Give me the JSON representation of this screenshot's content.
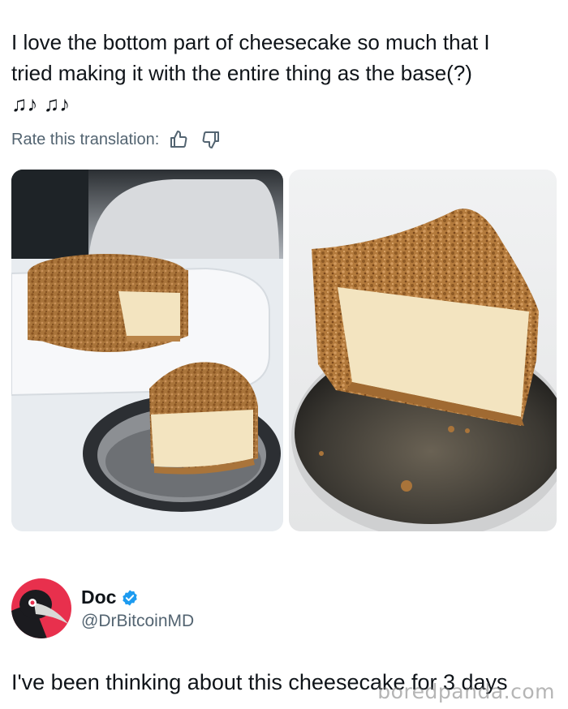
{
  "post": {
    "line1": "I love the bottom part of cheesecake so much that I",
    "line2": "tried making it with the entire thing as the base(?)",
    "line3": "♫♪ ♫♪"
  },
  "translation": {
    "label": "Rate this translation:",
    "thumbs_up_icon": "thumbs-up-icon",
    "thumbs_down_icon": "thumbs-down-icon"
  },
  "media": {
    "photos": [
      {
        "subject": "whole-cheesecake-and-slice-photo"
      },
      {
        "subject": "cheesecake-slice-closeup-photo"
      }
    ]
  },
  "reply": {
    "display_name": "Doc",
    "handle": "@DrBitcoinMD",
    "verified_icon": "verified-badge-icon",
    "avatar_icon": "plague-doctor-avatar",
    "text": "I've been thinking about this cheesecake for 3 days"
  },
  "watermark": "boredpanda.com",
  "colors": {
    "text": "#0f1419",
    "secondary": "#536471",
    "verified": "#1d9bf0",
    "crust": "#a9743a",
    "cheese": "#f3e4c0"
  }
}
